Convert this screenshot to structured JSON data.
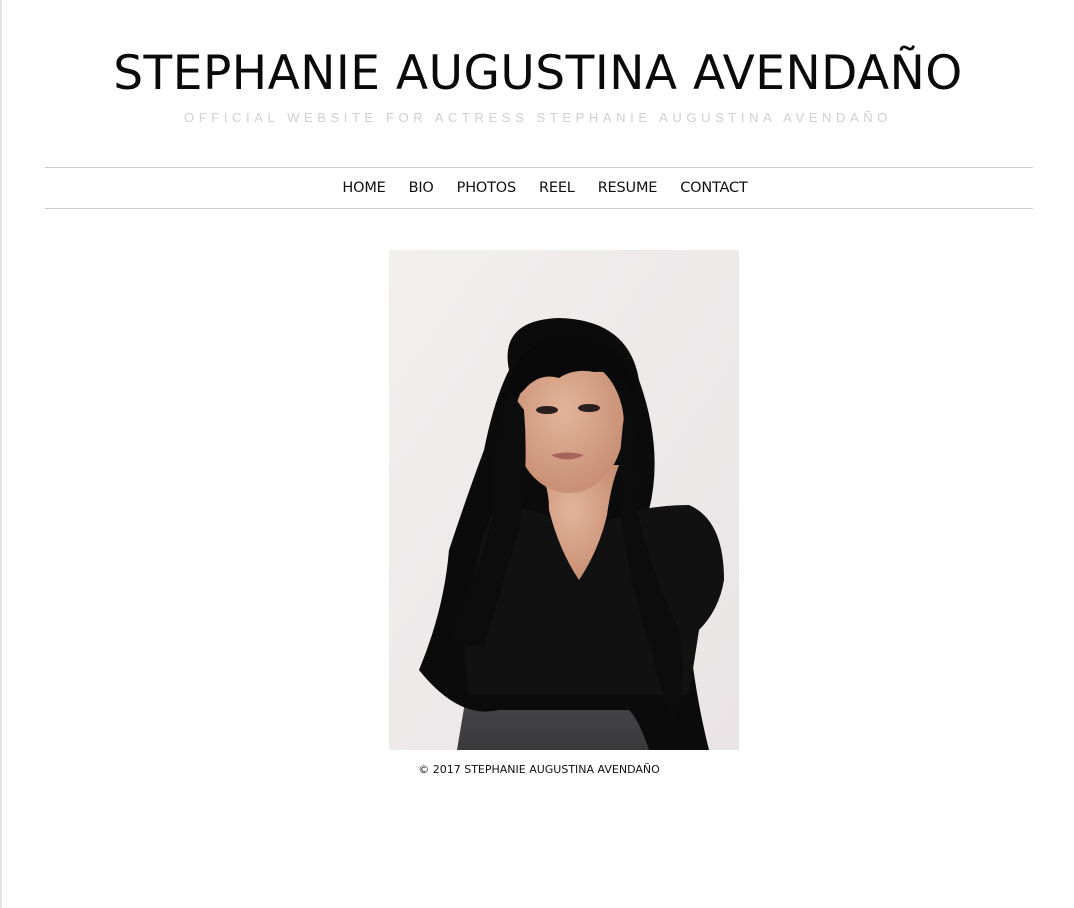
{
  "header": {
    "title": "STEPHANIE AUGUSTINA AVENDAÑO",
    "tagline": "OFFICIAL WEBSITE FOR ACTRESS STEPHANIE AUGUSTINA AVENDAÑO"
  },
  "nav": {
    "items": [
      {
        "label": "HOME"
      },
      {
        "label": "BIO"
      },
      {
        "label": "PHOTOS"
      },
      {
        "label": "REEL"
      },
      {
        "label": "RESUME"
      },
      {
        "label": "CONTACT"
      }
    ]
  },
  "footer": {
    "copyright": "© 2017 STEPHANIE AUGUSTINA AVENDAÑO"
  },
  "colors": {
    "background": "#ffffff",
    "text": "#111111",
    "tagline": "#cfcfcf",
    "rule": "#cccccc"
  }
}
